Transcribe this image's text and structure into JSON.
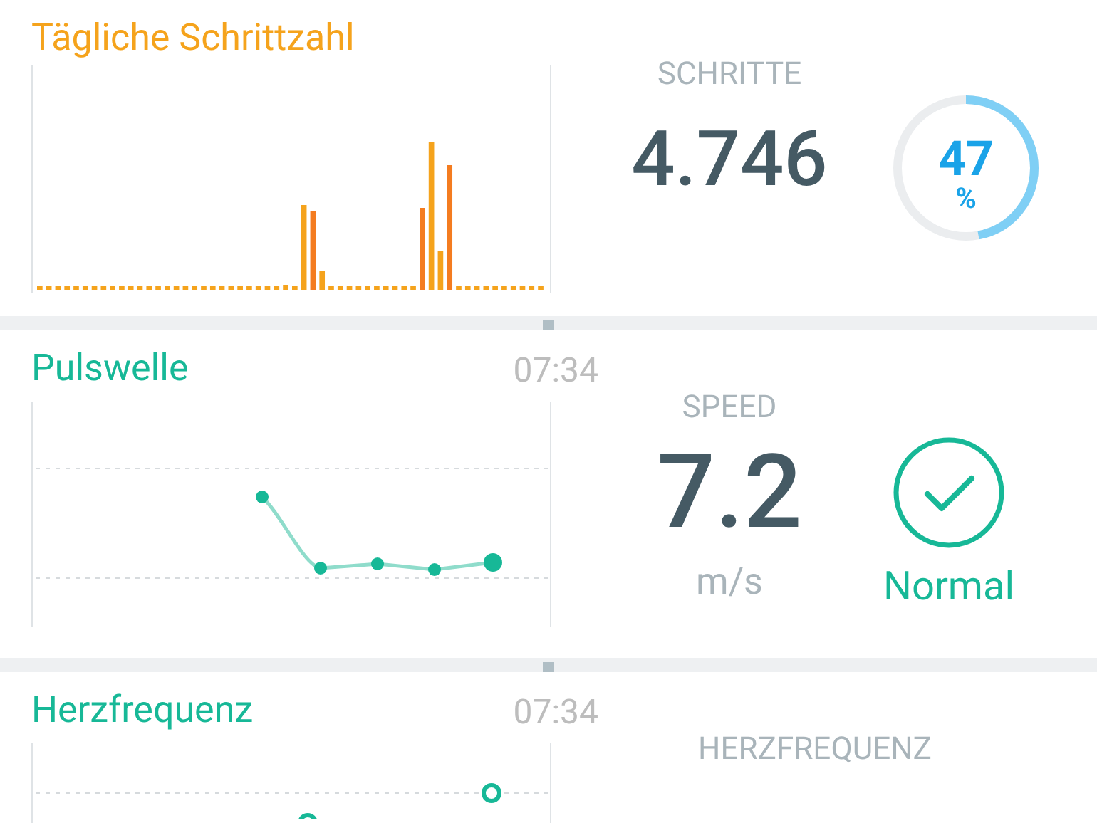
{
  "cards": [
    {
      "kind": "steps",
      "title": "Tägliche Schrittzahl",
      "metric_label": "SCHRITTE",
      "value": "4.746",
      "goal": {
        "value": "47",
        "unit": "%"
      }
    },
    {
      "kind": "speed",
      "title": "Pulswelle",
      "time": "07:34",
      "metric_label": "SPEED",
      "value": "7.2",
      "unit": "m/s",
      "status": "Normal"
    },
    {
      "kind": "heart",
      "title": "Herzfrequenz",
      "time": "07:34",
      "metric_label": "HERZFREQUENZ"
    }
  ]
}
